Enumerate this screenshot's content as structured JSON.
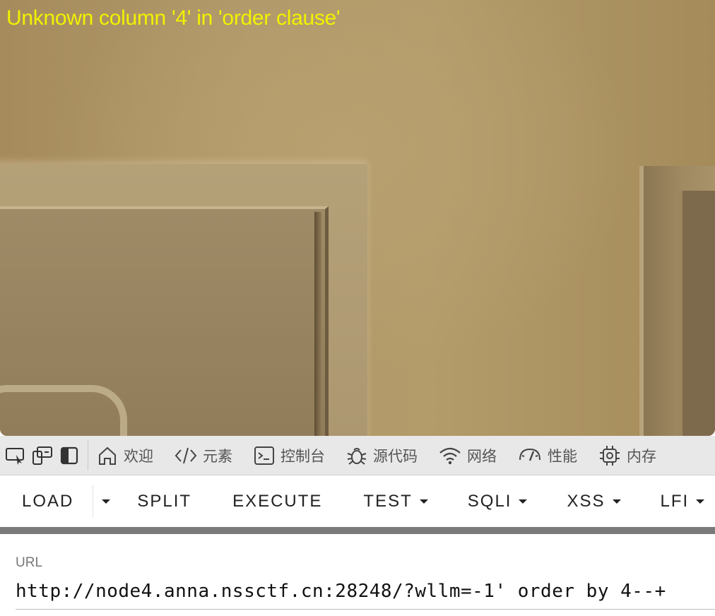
{
  "page": {
    "error_message": "Unknown column '4' in 'order clause'"
  },
  "devtools": {
    "tabs": [
      {
        "icon": "home-icon",
        "label": "欢迎"
      },
      {
        "icon": "code-icon",
        "label": "元素"
      },
      {
        "icon": "console-icon",
        "label": "控制台"
      },
      {
        "icon": "bug-icon",
        "label": "源代码"
      },
      {
        "icon": "wifi-icon",
        "label": "网络"
      },
      {
        "icon": "gauge-icon",
        "label": "性能"
      },
      {
        "icon": "chip-icon",
        "label": "内存"
      }
    ]
  },
  "hackbar": {
    "load_label": "LOAD",
    "split_label": "SPLIT",
    "execute_label": "EXECUTE",
    "test_label": "TEST",
    "sqli_label": "SQLI",
    "xss_label": "XSS",
    "lfi_label": "LFI"
  },
  "url_field": {
    "label": "URL",
    "value": "http://node4.anna.nssctf.cn:28248/?wllm=-1' order by 4--+"
  },
  "colors": {
    "error_text": "#f2f200",
    "hackbar_divider": "#7a7a7a"
  }
}
